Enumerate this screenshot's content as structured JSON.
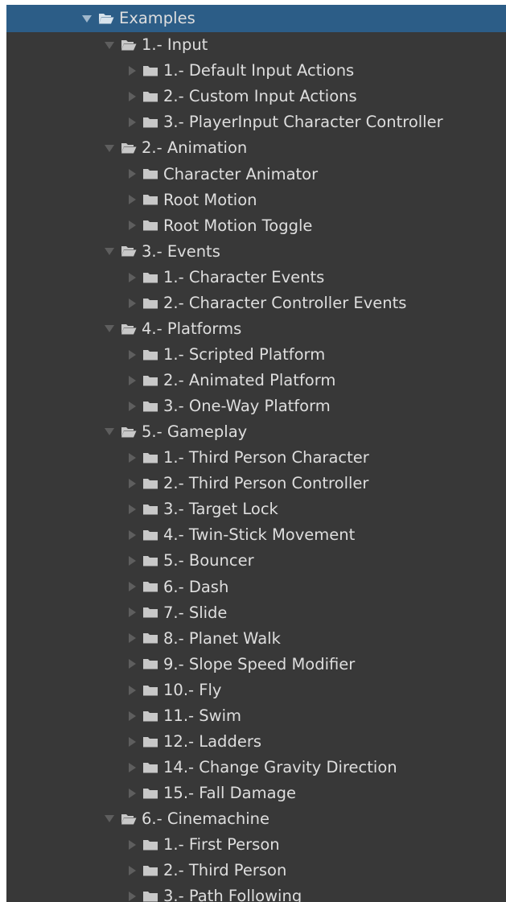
{
  "tree": {
    "root": {
      "label": "Examples",
      "state": "open",
      "selected": true
    },
    "items": [
      {
        "label": "1.- Input",
        "state": "open",
        "level": 1
      },
      {
        "label": "1.- Default Input Actions",
        "state": "closed",
        "level": 2
      },
      {
        "label": "2.- Custom Input Actions",
        "state": "closed",
        "level": 2
      },
      {
        "label": "3.- PlayerInput Character Controller",
        "state": "closed",
        "level": 2
      },
      {
        "label": "2.- Animation",
        "state": "open",
        "level": 1
      },
      {
        "label": "Character Animator",
        "state": "closed",
        "level": 2
      },
      {
        "label": "Root Motion",
        "state": "closed",
        "level": 2
      },
      {
        "label": "Root Motion Toggle",
        "state": "closed",
        "level": 2
      },
      {
        "label": "3.- Events",
        "state": "open",
        "level": 1
      },
      {
        "label": "1.- Character Events",
        "state": "closed",
        "level": 2
      },
      {
        "label": "2.- Character Controller Events",
        "state": "closed",
        "level": 2
      },
      {
        "label": "4.- Platforms",
        "state": "open",
        "level": 1
      },
      {
        "label": "1.- Scripted Platform",
        "state": "closed",
        "level": 2
      },
      {
        "label": "2.- Animated Platform",
        "state": "closed",
        "level": 2
      },
      {
        "label": "3.- One-Way Platform",
        "state": "closed",
        "level": 2
      },
      {
        "label": "5.- Gameplay",
        "state": "open",
        "level": 1
      },
      {
        "label": "1.- Third Person Character",
        "state": "closed",
        "level": 2
      },
      {
        "label": "2.- Third Person Controller",
        "state": "closed",
        "level": 2
      },
      {
        "label": "3.- Target Lock",
        "state": "closed",
        "level": 2
      },
      {
        "label": "4.- Twin-Stick Movement",
        "state": "closed",
        "level": 2
      },
      {
        "label": "5.- Bouncer",
        "state": "closed",
        "level": 2
      },
      {
        "label": "6.- Dash",
        "state": "closed",
        "level": 2
      },
      {
        "label": "7.- Slide",
        "state": "closed",
        "level": 2
      },
      {
        "label": "8.- Planet Walk",
        "state": "closed",
        "level": 2
      },
      {
        "label": "9.- Slope Speed Modifier",
        "state": "closed",
        "level": 2
      },
      {
        "label": "10.- Fly",
        "state": "closed",
        "level": 2
      },
      {
        "label": "11.- Swim",
        "state": "closed",
        "level": 2
      },
      {
        "label": "12.- Ladders",
        "state": "closed",
        "level": 2
      },
      {
        "label": "14.- Change Gravity Direction",
        "state": "closed",
        "level": 2
      },
      {
        "label": "15.- Fall Damage",
        "state": "closed",
        "level": 2
      },
      {
        "label": "6.- Cinemachine",
        "state": "open",
        "level": 1
      },
      {
        "label": "1.- First Person",
        "state": "closed",
        "level": 2
      },
      {
        "label": "2.- Third Person",
        "state": "closed",
        "level": 2
      },
      {
        "label": "3.- Path Following",
        "state": "closed",
        "level": 2
      }
    ]
  },
  "colors": {
    "background": "#383838",
    "selected": "#2c5d87",
    "text": "#dedede",
    "arrow": "#5e5e5e",
    "folder": "#c8c8c8"
  },
  "icons": {
    "open_folder": "folder-open-icon",
    "closed_folder": "folder-icon",
    "expanded": "triangle-down-icon",
    "collapsed": "triangle-right-icon"
  }
}
